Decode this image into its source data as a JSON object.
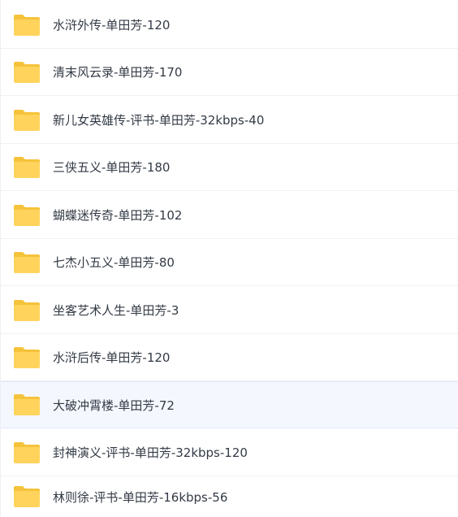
{
  "file_list": {
    "items": [
      {
        "name": "水浒外传-单田芳-120",
        "icon": "folder-icon"
      },
      {
        "name": "清末风云录-单田芳-170",
        "icon": "folder-icon"
      },
      {
        "name": "新儿女英雄传-评书-单田芳-32kbps-40",
        "icon": "folder-icon"
      },
      {
        "name": "三侠五义-单田芳-180",
        "icon": "folder-icon"
      },
      {
        "name": "蝴蝶迷传奇-单田芳-102",
        "icon": "folder-icon"
      },
      {
        "name": "七杰小五义-单田芳-80",
        "icon": "folder-icon"
      },
      {
        "name": "坐客艺术人生-单田芳-3",
        "icon": "folder-icon"
      },
      {
        "name": "水浒后传-单田芳-120",
        "icon": "folder-icon"
      },
      {
        "name": "大破冲霄楼-单田芳-72",
        "icon": "folder-icon",
        "selected": true
      },
      {
        "name": "封神演义-评书-单田芳-32kbps-120",
        "icon": "folder-icon"
      },
      {
        "name": "林则徐-评书-单田芳-16kbps-56",
        "icon": "folder-icon"
      }
    ]
  },
  "colors": {
    "folder": "#ffd35c",
    "folder_tab": "#f5c33b",
    "selected_background": "#f4f8fe",
    "text": "#333a45"
  }
}
